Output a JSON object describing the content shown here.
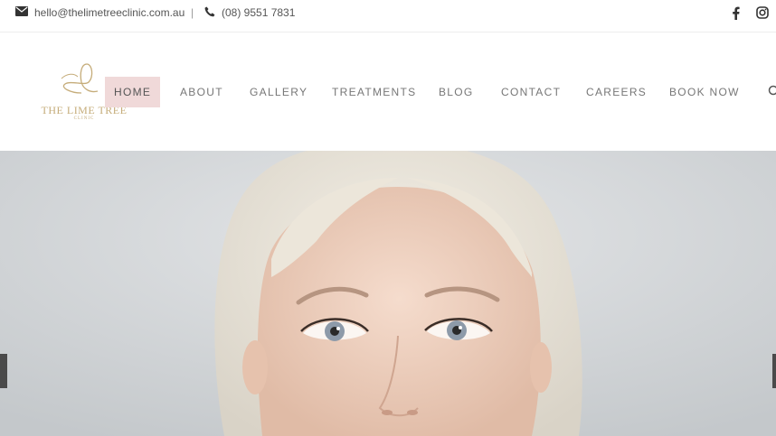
{
  "topbar": {
    "email": "hello@thelimetreeclinic.com.au",
    "separator": "|",
    "phone": "(08) 9551 7831",
    "social": [
      "facebook-icon",
      "instagram-icon"
    ]
  },
  "logo": {
    "name": "THE LIME TREE",
    "sub": "CLINIC",
    "color": "#c5ac79"
  },
  "nav": {
    "items": [
      {
        "label": "HOME",
        "active": true
      },
      {
        "label": "ABOUT",
        "active": false
      },
      {
        "label": "GALLERY",
        "active": false
      },
      {
        "label": "TREATMENTS",
        "active": false
      },
      {
        "label": "BLOG",
        "active": false
      },
      {
        "label": "CONTACT",
        "active": false
      },
      {
        "label": "CAREERS",
        "active": false
      },
      {
        "label": "BOOK NOW",
        "active": false
      }
    ],
    "active_bg": "#f0d9d9"
  },
  "hero": {
    "image": "portrait of a platinum blonde woman against a light grey background"
  }
}
